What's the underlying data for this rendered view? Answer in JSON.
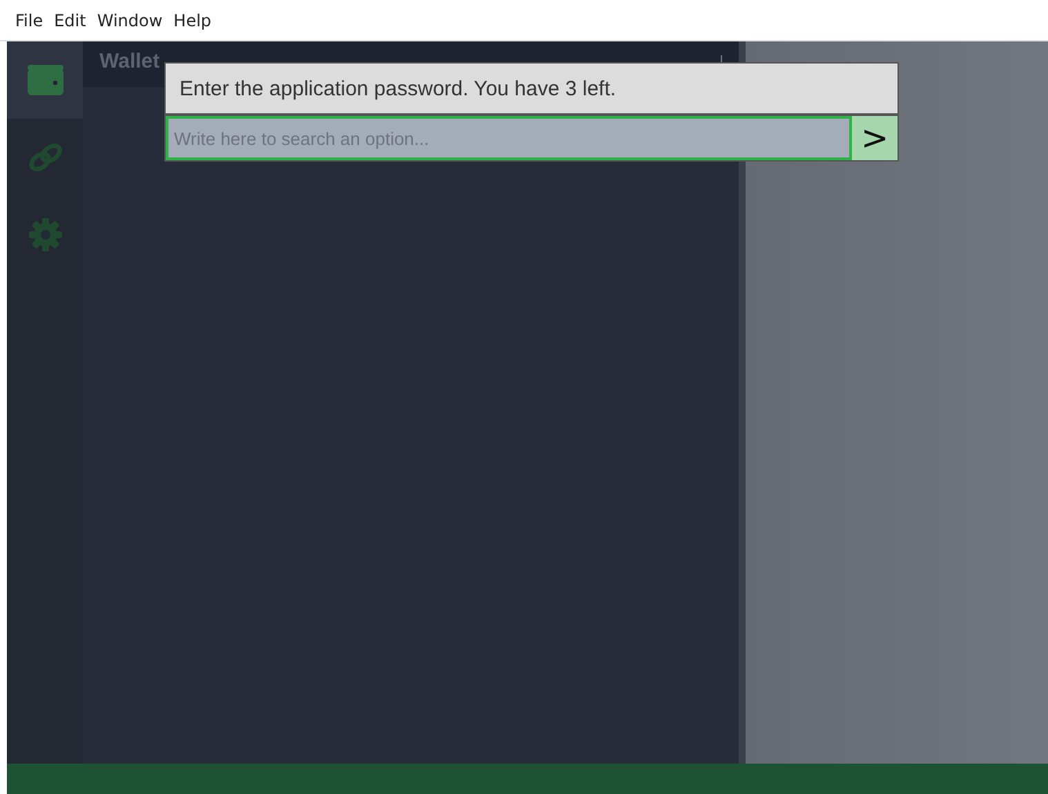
{
  "menu_bar": [
    "File",
    "Edit",
    "Window",
    "Help"
  ],
  "sidebar": {
    "items": [
      {
        "kind": "wallet",
        "selected": true
      },
      {
        "kind": "link",
        "selected": false
      },
      {
        "kind": "gear",
        "selected": false
      }
    ]
  },
  "panel": {
    "title": "Wallet"
  },
  "dialog": {
    "message": "Enter the application password. You have 3 left.",
    "input": {
      "placeholder": "Write here to search an option..."
    },
    "submit": ">"
  }
}
